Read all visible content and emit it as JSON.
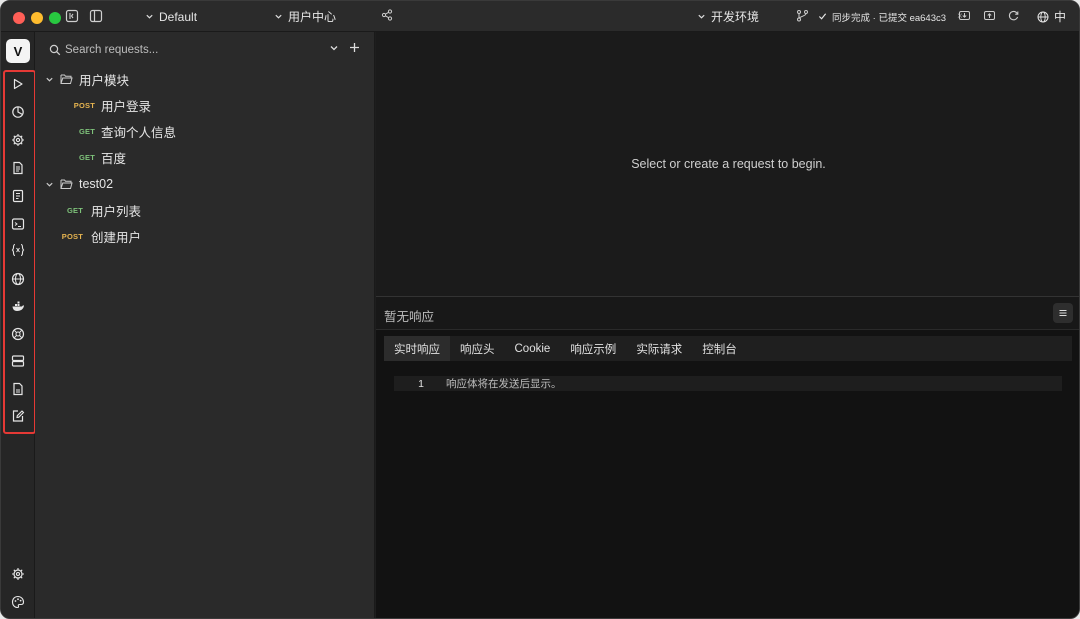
{
  "titlebar": {
    "workspace": "Default",
    "project": "用户中心",
    "environment": "开发环境",
    "sync_status": "同步完成 · 已提交 ea643c3",
    "sync_close": "×",
    "language": "中"
  },
  "activity": {
    "logo": "V",
    "icons": [
      "run-icon",
      "history-icon",
      "settings-cog-icon",
      "document-icon",
      "notebook-icon",
      "terminal-icon",
      "variables-icon",
      "globe-icon",
      "docker-icon",
      "plugin-icon",
      "server-icon",
      "file-icon",
      "edit-icon"
    ],
    "bottom_icons": [
      "gear-icon",
      "palette-icon"
    ]
  },
  "sidebar": {
    "search_placeholder": "Search requests...",
    "folders": [
      {
        "name": "用户模块",
        "requests": [
          {
            "method": "POST",
            "name": "用户登录"
          },
          {
            "method": "GET",
            "name": "查询个人信息"
          },
          {
            "method": "GET",
            "name": "百度"
          }
        ]
      },
      {
        "name": "test02",
        "requests": [
          {
            "method": "GET",
            "name": "用户列表"
          },
          {
            "method": "POST",
            "name": "创建用户"
          }
        ]
      }
    ]
  },
  "main": {
    "empty_message": "Select or create a request to begin."
  },
  "response": {
    "title": "暂无响应",
    "tabs": [
      "实时响应",
      "响应头",
      "Cookie",
      "响应示例",
      "实际请求",
      "控制台"
    ],
    "line_number": "1",
    "body_placeholder": "响应体将在发送后显示。"
  },
  "colors": {
    "post": "#e6b450",
    "get": "#7ec27a",
    "highlight": "#e53935"
  }
}
